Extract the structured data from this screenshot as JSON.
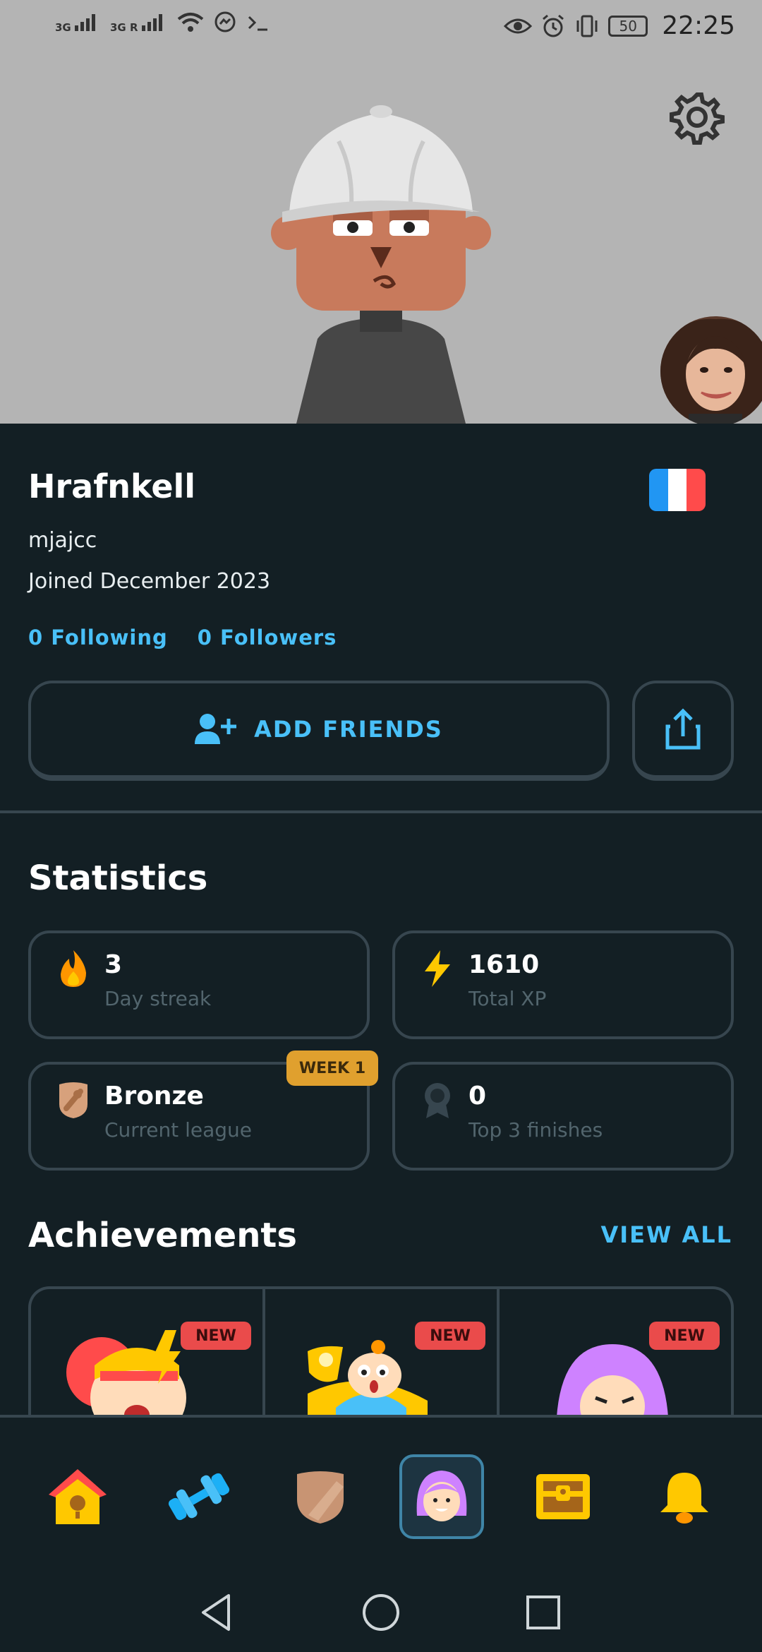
{
  "status_bar": {
    "network1": "3G",
    "network2": "3G R",
    "battery": "50",
    "time": "22:25",
    "icons": [
      "signal-icon",
      "signal-icon",
      "wifi-icon",
      "messenger-icon",
      "terminal-icon",
      "eye-icon",
      "alarm-icon",
      "vibrate-icon",
      "battery-icon"
    ]
  },
  "profile": {
    "display_name": "Hrafnkell",
    "username": "mjajcc",
    "joined": "Joined December 2023",
    "following": "0 Following",
    "followers": "0 Followers",
    "course_flag": "france-flag-icon"
  },
  "actions": {
    "add_friends": "ADD FRIENDS",
    "share_icon": "share-icon"
  },
  "statistics": {
    "title": "Statistics",
    "cards": [
      {
        "value": "3",
        "label": "Day streak",
        "icon": "fire-icon"
      },
      {
        "value": "1610",
        "label": "Total XP",
        "icon": "lightning-icon"
      },
      {
        "value": "Bronze",
        "label": "Current league",
        "icon": "bronze-league-icon",
        "badge": "WEEK 1"
      },
      {
        "value": "0",
        "label": "Top 3 finishes",
        "icon": "medal-icon"
      }
    ]
  },
  "achievements": {
    "title": "Achievements",
    "view_all": "VIEW ALL",
    "items": [
      {
        "badge": "NEW"
      },
      {
        "badge": "NEW"
      },
      {
        "badge": "NEW"
      }
    ]
  },
  "nav": {
    "items": [
      "home-icon",
      "practice-icon",
      "league-icon",
      "profile-icon",
      "shop-icon",
      "notifications-icon"
    ],
    "active": "profile-icon"
  },
  "colors": {
    "background": "#131f24",
    "border": "#37464f",
    "accent_blue": "#49c0f8",
    "header_gray": "#b4b4b4",
    "new_badge": "#ea4b4b",
    "week_badge": "#e0a02e"
  }
}
